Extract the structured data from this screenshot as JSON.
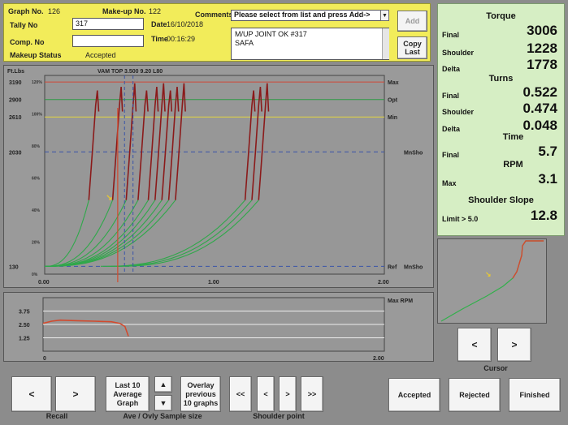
{
  "header": {
    "graph_no_label": "Graph No.",
    "graph_no_value": "126",
    "makeup_no_label": "Make-up No.",
    "makeup_no_value": "122",
    "tally_no_label": "Tally No",
    "tally_no_value": "317",
    "date_label": "Date",
    "date_value": "16/10/2018",
    "comp_no_label": "Comp. No",
    "comp_no_value": "",
    "time_label": "Time",
    "time_value": "00:16:29",
    "makeup_status_label": "Makeup Status",
    "makeup_status_value": "Accepted",
    "comments_label": "Comments",
    "comments_select": "Please select from list and press Add->",
    "comments_lines": [
      "M/UP JOINT OK #317",
      "SAFA"
    ],
    "add_label": "Add",
    "copy_last_label": "Copy Last"
  },
  "summary": {
    "torque_title": "Torque",
    "torque_rows": [
      {
        "label": "Final",
        "value": "3006"
      },
      {
        "label": "Shoulder",
        "value": "1228"
      },
      {
        "label": "Delta",
        "value": "1778"
      }
    ],
    "turns_title": "Turns",
    "turns_rows": [
      {
        "label": "Final",
        "value": "0.522"
      },
      {
        "label": "Shoulder",
        "value": "0.474"
      },
      {
        "label": "Delta",
        "value": "0.048"
      }
    ],
    "time_title": "Time",
    "time_rows": [
      {
        "label": "Final",
        "value": "5.7"
      }
    ],
    "rpm_title": "RPM",
    "rpm_rows": [
      {
        "label": "Max",
        "value": "3.1"
      }
    ],
    "slope_title": "Shoulder Slope",
    "slope_rows": [
      {
        "label": "Limit > 5.0",
        "value": "12.8"
      }
    ]
  },
  "chart_data": [
    {
      "type": "line",
      "title": "VAM TOP 3.500 9.20 L80",
      "ylabel": "Ft.Lbs",
      "x_ticks": [
        "0.00",
        "1.00",
        "2.00"
      ],
      "xlim": [
        0,
        2
      ],
      "y_ticks": [
        "3190",
        "2900",
        "2610",
        "2030",
        "130"
      ],
      "pct_ticks": [
        "120%",
        "100%",
        "80%",
        "60%",
        "40%",
        "20%",
        "0%"
      ],
      "ref_lines": [
        {
          "name": "Max",
          "value": 3190,
          "color": "#d04a3a"
        },
        {
          "name": "Opt",
          "value": 2900,
          "color": "#2e9a46"
        },
        {
          "name": "Min",
          "value": 2610,
          "color": "#e4d640"
        },
        {
          "name": "MnSho",
          "value": 2030,
          "color": "#3a55a8"
        },
        {
          "name": "Ref",
          "value": 130,
          "color": "#3a55a8"
        }
      ],
      "right_labels": [
        "Max",
        "Opt",
        "Min",
        "MnSho",
        "Ref",
        "MnSho"
      ],
      "final_peaks_x": [
        0.31,
        0.45,
        0.53,
        0.6,
        0.66,
        0.7,
        0.74,
        0.78,
        0.82,
        1.23,
        1.27,
        1.31
      ],
      "current_shoulder_x": 0.47,
      "current_final_x": 0.52
    },
    {
      "type": "line",
      "title": "",
      "xlabel_ticks": [
        "0",
        "2.00"
      ],
      "y_ticks": [
        "3.75",
        "2.50",
        "1.25"
      ],
      "right_label": "Max RPM",
      "series": [
        {
          "name": "RPM",
          "x": [
            0.0,
            0.05,
            0.1,
            0.2,
            0.3,
            0.4,
            0.45,
            0.48,
            0.5
          ],
          "y": [
            2.6,
            2.8,
            2.9,
            2.85,
            2.8,
            2.75,
            2.6,
            2.3,
            1.4
          ]
        }
      ]
    }
  ],
  "cursor_label": "Cursor",
  "bottom": {
    "recall_label": "Recall",
    "last10_label": "Last 10 Average Graph",
    "overlay_label": "Overlay previous 10 graphs",
    "ave_label": "Ave / Ovly Sample size",
    "shoulder_point_label": "Shoulder point",
    "first_label": "<<",
    "prev_label": "<",
    "next_label": ">",
    "last_label": ">>",
    "left_label": "<",
    "right_label": ">",
    "accepted_label": "Accepted",
    "rejected_label": "Rejected",
    "finished_label": "Finished"
  }
}
